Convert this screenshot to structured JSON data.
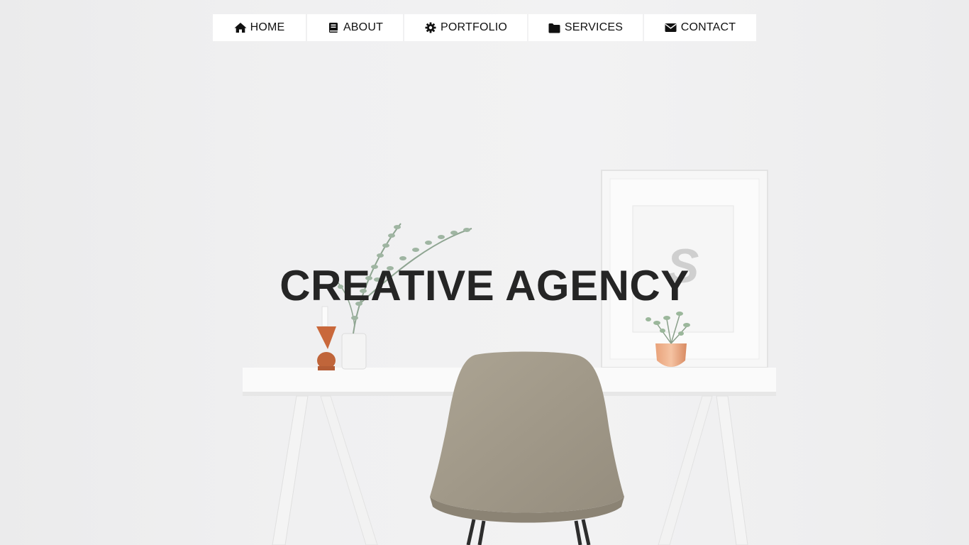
{
  "nav": {
    "items": [
      {
        "label": "HOME",
        "icon": "home-icon"
      },
      {
        "label": "ABOUT",
        "icon": "book-icon"
      },
      {
        "label": "PORTFOLIO",
        "icon": "gear-icon"
      },
      {
        "label": "SERVICES",
        "icon": "folder-icon"
      },
      {
        "label": "CONTACT",
        "icon": "envelope-icon"
      }
    ]
  },
  "hero": {
    "title": "CREATIVE AGENCY"
  },
  "colors": {
    "background": "#efeff0",
    "nav_background": "#ffffff",
    "title_text": "#252525",
    "chair": "#a39b8c"
  }
}
